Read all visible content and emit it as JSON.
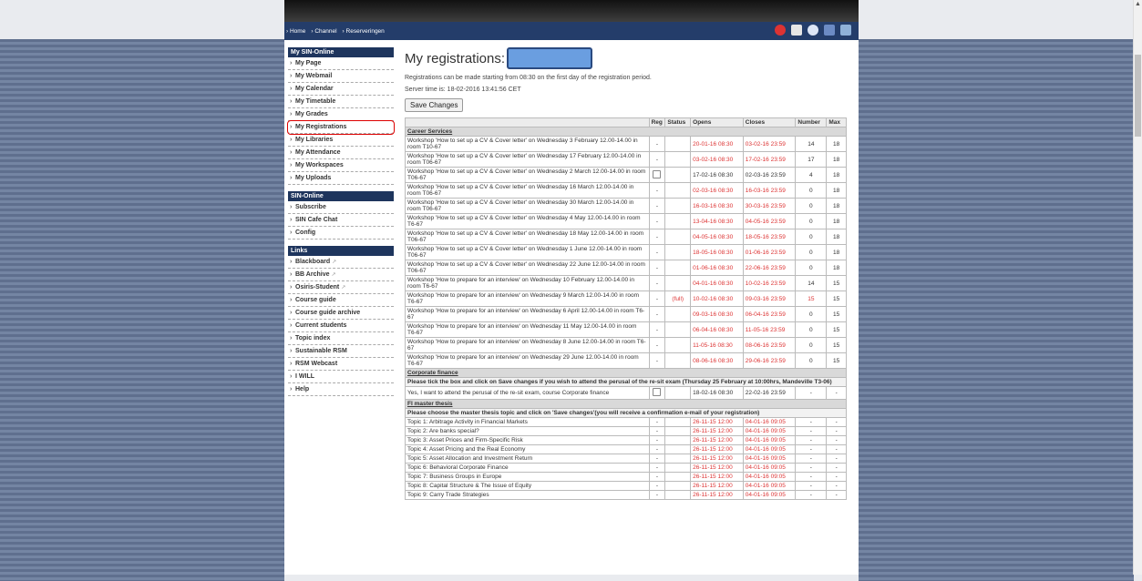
{
  "topnav": {
    "breadcrumbs": [
      "Home",
      "Channel",
      "Reserveringen"
    ],
    "icons": [
      "alarm-icon",
      "document-icon",
      "search-icon",
      "people-icon",
      "monitor-icon"
    ]
  },
  "sidebar": {
    "sections": [
      {
        "title": "My SIN-Online",
        "items": [
          "My Page",
          "My Webmail",
          "My Calendar",
          "My Timetable",
          "My Grades",
          "My Registrations",
          "My Libraries",
          "My Attendance",
          "My Workspaces",
          "My Uploads"
        ]
      },
      {
        "title": "SIN-Online",
        "items": [
          "Subscribe",
          "SIN Cafe Chat",
          "Config"
        ]
      },
      {
        "title": "Links",
        "items": [
          "Blackboard",
          "BB Archive",
          "Osiris-Student",
          "Course guide",
          "Course guide archive",
          "Current students",
          "Topic index",
          "Sustainable RSM",
          "RSM Webcast",
          "I WILL",
          "Help"
        ]
      }
    ],
    "active_item": "My Registrations",
    "external_link_glyph": "↗"
  },
  "main": {
    "title": "My registrations:",
    "info_line": "Registrations can be made starting from 08:30 on the first day of the registration period.",
    "server_time": "Server time is: 18-02-2016 13:41:56 CET",
    "save_label": "Save Changes"
  },
  "table": {
    "headers": [
      "",
      "Reg",
      "Status",
      "Opens",
      "Closes",
      "Number",
      "Max"
    ],
    "career_services": "Career Services",
    "career_rows": [
      {
        "name": "Workshop 'How to set up a CV & Cover letter' on Wednesday 3 February 12.00-14.00 in room T10-67",
        "reg": "-",
        "status": "",
        "opens": "20-01-16 08:30",
        "closes": "03-02-16 23:59",
        "number": "14",
        "max": "18"
      },
      {
        "name": "Workshop 'How to set up a CV & Cover letter' on Wednesday 17 February 12.00-14.00 in room T06-67",
        "reg": "-",
        "status": "",
        "opens": "03-02-16 08:30",
        "closes": "17-02-16 23:59",
        "number": "17",
        "max": "18"
      },
      {
        "name": "Workshop 'How to set up a CV & Cover letter' on Wednesday 2 March 12.00-14.00 in room T06-67",
        "reg": "checkbox",
        "status": "",
        "opens": "17-02-16 08:30",
        "closes": "02-03-16 23:59",
        "number": "4",
        "max": "18"
      },
      {
        "name": "Workshop 'How to set up a CV & Cover letter' on Wednesday 16 March 12.00-14.00 in room T06-67",
        "reg": "-",
        "status": "",
        "opens": "02-03-16 08:30",
        "closes": "16-03-16 23:59",
        "number": "0",
        "max": "18"
      },
      {
        "name": "Workshop 'How to set up a CV & Cover letter' on Wednesday 30 March 12.00-14.00 in room T06-67",
        "reg": "-",
        "status": "",
        "opens": "16-03-16 08:30",
        "closes": "30-03-16 23:59",
        "number": "0",
        "max": "18"
      },
      {
        "name": "Workshop 'How to set up a CV & Cover letter' on Wednesday 4 May 12.00-14.00 in room T6-67",
        "reg": "-",
        "status": "",
        "opens": "13-04-16 08:30",
        "closes": "04-05-16 23:59",
        "number": "0",
        "max": "18"
      },
      {
        "name": "Workshop 'How to set up a CV & Cover letter' on Wednesday 18 May 12.00-14.00 in room T06-67",
        "reg": "-",
        "status": "",
        "opens": "04-05-16 08:30",
        "closes": "18-05-16 23:59",
        "number": "0",
        "max": "18"
      },
      {
        "name": "Workshop 'How to set up a CV & Cover letter' on Wednesday 1 June 12.00-14.00 in room T06-67",
        "reg": "-",
        "status": "",
        "opens": "18-05-16 08:30",
        "closes": "01-06-16 23:59",
        "number": "0",
        "max": "18"
      },
      {
        "name": "Workshop 'How to set up a CV & Cover letter' on Wednesday 22 June 12.00-14.00 in room T06-67",
        "reg": "-",
        "status": "",
        "opens": "01-06-16 08:30",
        "closes": "22-06-16 23:59",
        "number": "0",
        "max": "18"
      },
      {
        "name": "Workshop 'How to prepare for an interview' on Wednesday 10 February 12.00-14.00 in room T6-67",
        "reg": "-",
        "status": "",
        "opens": "04-01-16 08:30",
        "closes": "10-02-16 23:59",
        "number": "14",
        "max": "15"
      },
      {
        "name": "Workshop 'How to prepare for an interview' on Wednesday 9 March 12.00-14.00 in room T6-67",
        "reg": "-",
        "status": "(full)",
        "opens": "10-02-16 08:30",
        "closes": "09-03-16 23:59",
        "number": "15",
        "max": "15"
      },
      {
        "name": "Workshop 'How to prepare for an interview' on Wednesday 6 April 12.00-14.00 in room T6-67",
        "reg": "-",
        "status": "",
        "opens": "09-03-16 08:30",
        "closes": "06-04-16 23:59",
        "number": "0",
        "max": "15"
      },
      {
        "name": "Workshop 'How to prepare for an interview' on Wednesday 11 May 12.00-14.00 in room T6-67",
        "reg": "-",
        "status": "",
        "opens": "06-04-16 08:30",
        "closes": "11-05-16 23:59",
        "number": "0",
        "max": "15"
      },
      {
        "name": "Workshop 'How to prepare for an interview' on Wednesday 8 June 12.00-14.00 in room T6-67",
        "reg": "-",
        "status": "",
        "opens": "11-05-16 08:30",
        "closes": "08-06-16 23:59",
        "number": "0",
        "max": "15"
      },
      {
        "name": "Workshop 'How to prepare for an interview' on Wednesday 29 June 12.00-14.00 in room T6-67",
        "reg": "-",
        "status": "",
        "opens": "08-06-16 08:30",
        "closes": "29-06-16 23:59",
        "number": "0",
        "max": "15"
      }
    ],
    "corporate_finance": "Corporate finance",
    "corporate_note": "Please tick the box and click on Save changes if you wish to attend the perusal of the re-sit exam (Thursday 25 February at 10:00hrs, Mandeville T3-06)",
    "corporate_row": {
      "name": "Yes, I want to attend the perusal of the re-sit exam, course Corporate finance",
      "opens": "18-02-16 08:30",
      "closes": "22-02-16 23:59",
      "number": "-",
      "max": "-"
    },
    "fi_master": "FI master thesis",
    "fi_note": "Please choose the master thesis topic and click on 'Save changes'(you will receive a confirmation e-mail of your registration)",
    "fi_rows": [
      {
        "name": "Topic 1: Arbitrage Activity in Financial Markets"
      },
      {
        "name": "Topic 2: Are banks special?"
      },
      {
        "name": "Topic 3: Asset Prices and Firm-Specific Risk"
      },
      {
        "name": "Topic 4: Asset Pricing and the Real Economy"
      },
      {
        "name": "Topic 5: Asset Allocation and Investment Return"
      },
      {
        "name": "Topic 6: Behavioral Corporate Finance"
      },
      {
        "name": "Topic 7: Business Groups in Europe"
      },
      {
        "name": "Topic 8: Capital Structure & The Issue of Equity"
      },
      {
        "name": "Topic 9: Carry Trade Strategies"
      }
    ],
    "fi_opens": "26-11-15 12:00",
    "fi_closes": "04-01-16 09:05",
    "fi_dash": "-"
  }
}
